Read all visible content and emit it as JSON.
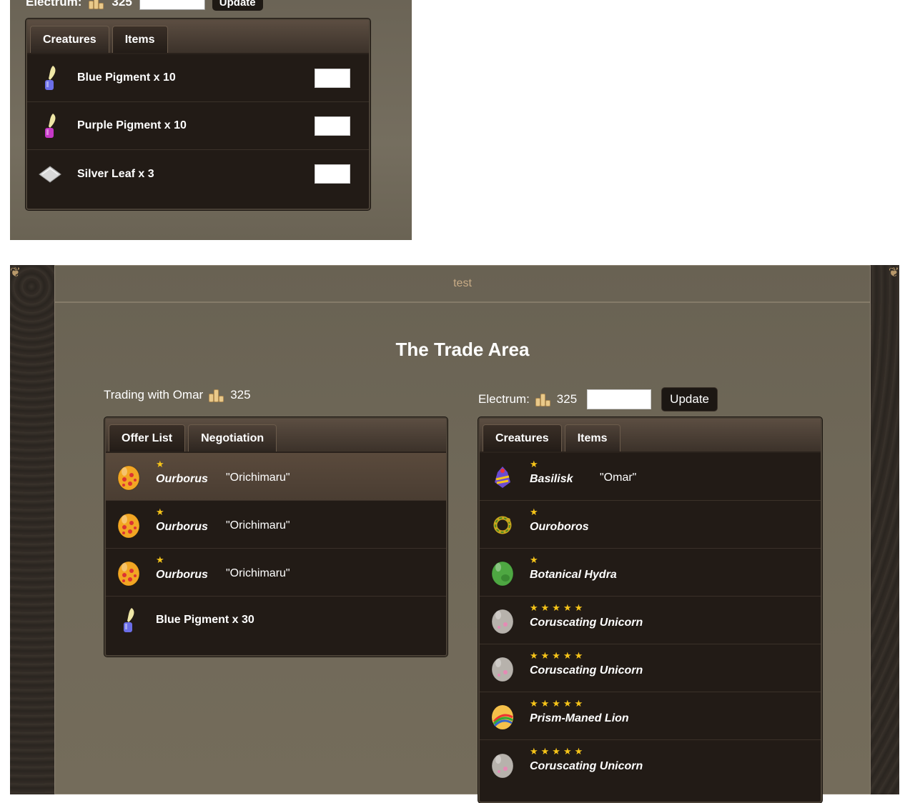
{
  "snippet": {
    "electrum_label": "Electrum:",
    "electrum_amount": "325",
    "update_label": "Update",
    "tabs": [
      "Creatures",
      "Items"
    ],
    "items": [
      {
        "name": "Blue Pigment x 10",
        "icon": "blue-pigment-icon"
      },
      {
        "name": "Purple Pigment x 10",
        "icon": "purple-pigment-icon"
      },
      {
        "name": "Silver Leaf x 3",
        "icon": "silver-leaf-icon"
      }
    ]
  },
  "main": {
    "header_title": "test",
    "page_title": "The Trade Area",
    "trading_with": "Trading with Omar",
    "trading_amount": "325",
    "electrum_label": "Electrum:",
    "electrum_amount": "325",
    "update_label": "Update",
    "offer_tabs": [
      "Offer List",
      "Negotiation"
    ],
    "offers": [
      {
        "stars": "★",
        "name": "Ourborus",
        "owner": "\"Orichimaru\"",
        "icon": "orange-egg-icon",
        "highlight": true
      },
      {
        "stars": "★",
        "name": "Ourborus",
        "owner": "\"Orichimaru\"",
        "icon": "orange-egg-icon"
      },
      {
        "stars": "★",
        "name": "Ourborus",
        "owner": "\"Orichimaru\"",
        "icon": "orange-egg-icon"
      }
    ],
    "offer_item": {
      "name": "Blue Pigment x 30",
      "icon": "blue-pigment-icon"
    },
    "inventory_tabs": [
      "Creatures",
      "Items"
    ],
    "creatures": [
      {
        "stars": "★",
        "name": "Basilisk",
        "owner": "\"Omar\"",
        "icon": "basilisk-icon"
      },
      {
        "stars": "★",
        "name": "Ouroboros",
        "owner": "",
        "icon": "ouroboros-icon"
      },
      {
        "stars": "★",
        "name": "Botanical Hydra",
        "owner": "",
        "icon": "green-egg-icon"
      },
      {
        "stars": "★★★★★",
        "name": "Coruscating Unicorn",
        "owner": "",
        "icon": "gray-egg-icon"
      },
      {
        "stars": "★★★★★",
        "name": "Coruscating Unicorn",
        "owner": "",
        "icon": "gray-egg-icon"
      },
      {
        "stars": "★★★★★",
        "name": "Prism-Maned Lion",
        "owner": "",
        "icon": "rainbow-egg-icon"
      },
      {
        "stars": "★★★★★",
        "name": "Coruscating Unicorn",
        "owner": "",
        "icon": "gray-egg-icon"
      }
    ]
  }
}
